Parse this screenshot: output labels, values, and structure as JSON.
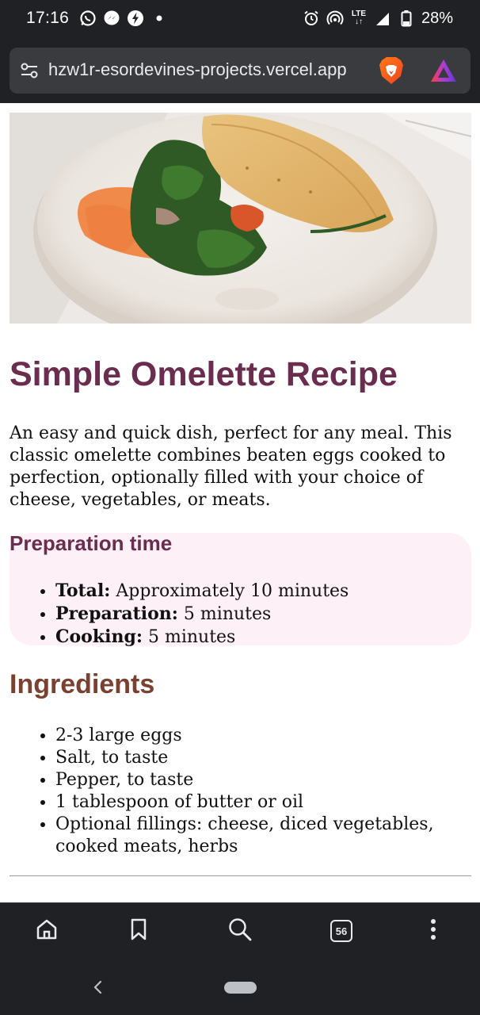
{
  "status_bar": {
    "time": "17:16",
    "battery": "28%",
    "network": "LTE",
    "left_icons": [
      "whatsapp-icon",
      "messenger-icon",
      "bolt-app-icon",
      "dot-icon"
    ],
    "right_icons": [
      "alarm-icon",
      "hotspot-icon",
      "lte-icon",
      "signal-icon",
      "battery-icon"
    ]
  },
  "browser": {
    "url": "hzw1r-esordevines-projects.vercel.app",
    "shield_icon": "brave-lion-icon",
    "rewards_icon": "brave-rewards-icon"
  },
  "recipe": {
    "hero_image": "omelette-crepe-photo",
    "title": "Simple Omelette Recipe",
    "intro": "An easy and quick dish, perfect for any meal. This classic omelette combines beaten eggs cooked to perfection, optionally filled with your choice of cheese, vegetables, or meats.",
    "prep": {
      "heading": "Preparation time",
      "items": [
        {
          "label": "Total:",
          "value": " Approximately 10 minutes"
        },
        {
          "label": "Preparation:",
          "value": " 5 minutes"
        },
        {
          "label": "Cooking:",
          "value": " 5 minutes"
        }
      ]
    },
    "ingredients": {
      "heading": "Ingredients",
      "items": [
        "2-3 large eggs",
        "Salt, to taste",
        "Pepper, to taste",
        "1 tablespoon of butter or oil",
        "Optional fillings: cheese, diced vegetables, cooked meats, herbs"
      ]
    }
  },
  "toolbar": {
    "tab_count": "56",
    "icons": [
      "home-icon",
      "bookmark-icon",
      "search-icon",
      "tabs-icon",
      "more-icon"
    ]
  },
  "colors": {
    "title": "#6b2d4f",
    "ingredients_heading": "#7a4030",
    "prep_box": "#fdf0f6",
    "chrome": "#202124"
  }
}
